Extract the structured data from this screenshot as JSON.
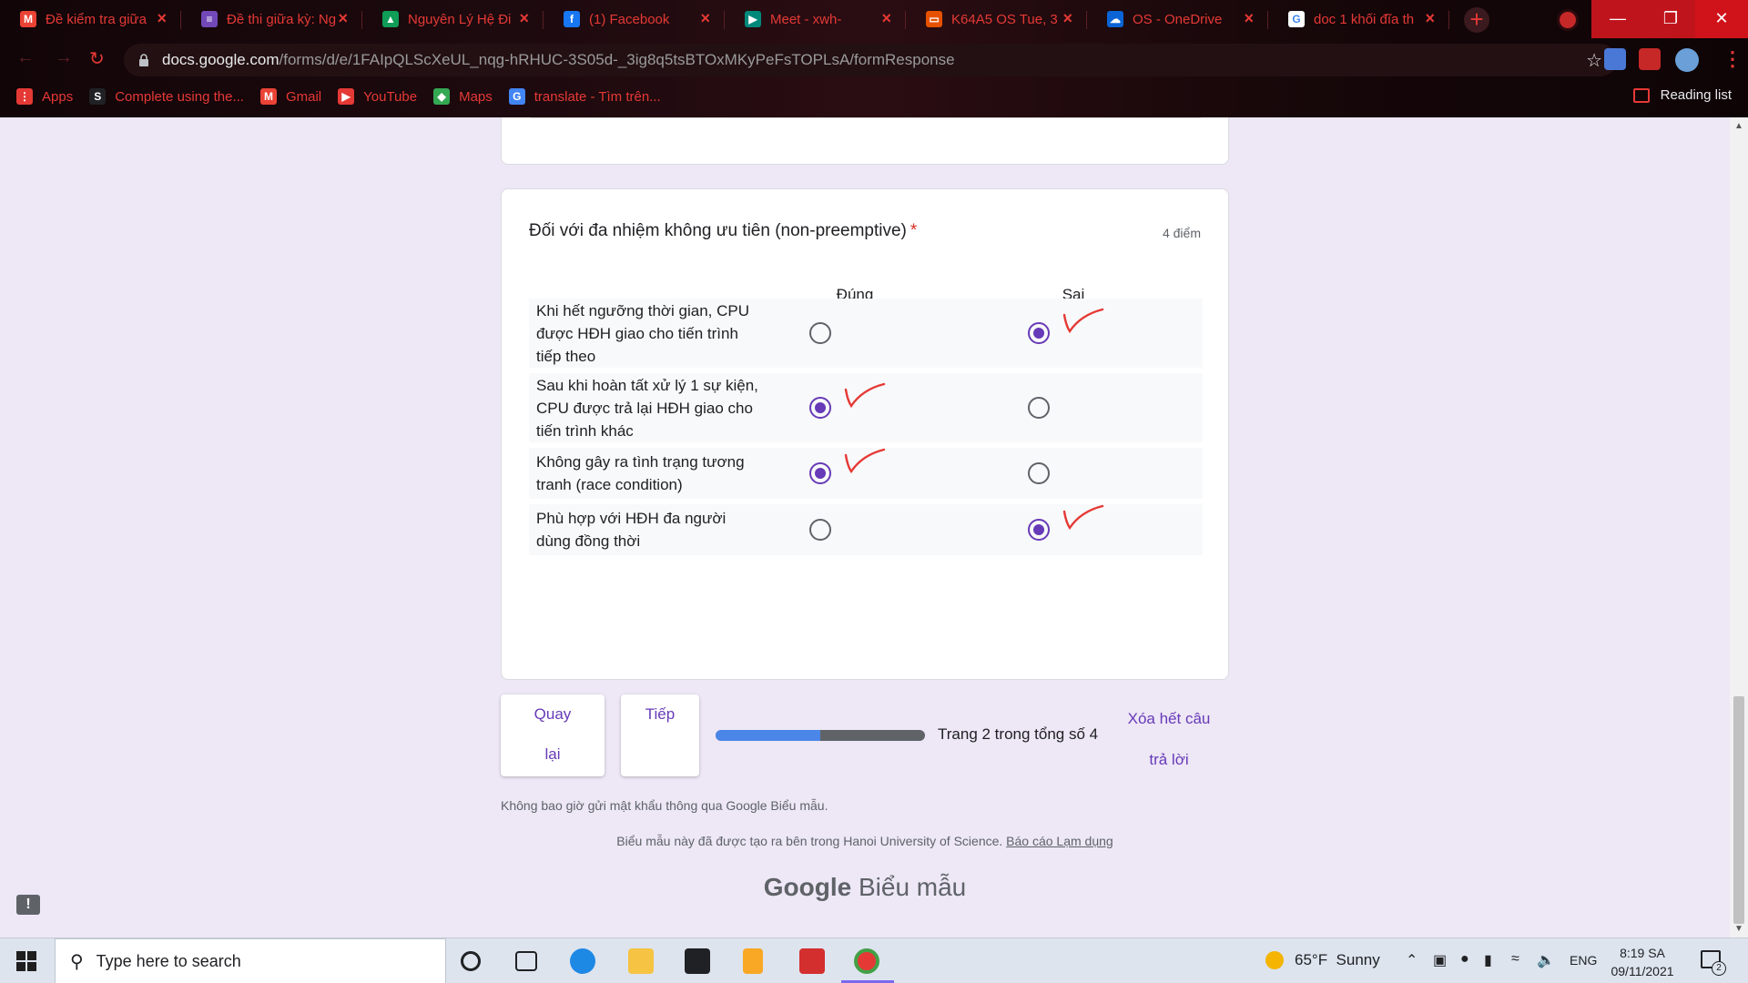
{
  "browser": {
    "tabs": [
      {
        "title": "Đề kiểm tra giữa",
        "favicon": "gmail-icon",
        "color": "#ea4335"
      },
      {
        "title": "Đề thi giữa kỳ: Ng",
        "favicon": "google-forms-icon",
        "color": "#7248b9"
      },
      {
        "title": "Nguyên Lý Hệ Đi",
        "favicon": "google-drive-icon",
        "color": "#0f9d58"
      },
      {
        "title": "(1) Facebook",
        "favicon": "facebook-icon",
        "color": "#1877f2"
      },
      {
        "title": "Meet - xwh-",
        "favicon": "google-meet-icon",
        "color": "#00897b"
      },
      {
        "title": "K64A5 OS Tue, 3",
        "favicon": "slides-icon",
        "color": "#e65100"
      },
      {
        "title": "OS - OneDrive",
        "favicon": "onedrive-icon",
        "color": "#0a64d6"
      },
      {
        "title": "doc 1 khối đĩa th",
        "favicon": "google-icon",
        "color": "#ffffff"
      }
    ],
    "url_host": "docs.google.com",
    "url_path": "/forms/d/e/1FAIpQLScXeUL_nqg-hRHUC-3S05d-_3ig8q5tsBTOxMKyPeFsTOPLsA/formResponse",
    "bookmarks": [
      {
        "label": "Apps",
        "icon": "apps-grid-icon"
      },
      {
        "label": "Complete using the...",
        "icon": "s-icon"
      },
      {
        "label": "Gmail",
        "icon": "gmail-icon"
      },
      {
        "label": "YouTube",
        "icon": "youtube-icon"
      },
      {
        "label": "Maps",
        "icon": "maps-icon"
      },
      {
        "label": "translate - Tìm trên...",
        "icon": "google-icon"
      }
    ],
    "reading_list": "Reading list"
  },
  "form": {
    "question": {
      "title": "Đối với đa nhiệm không ưu tiên (non-preemptive)",
      "required_mark": "*",
      "points": "4 điểm",
      "columns": [
        "Đúng",
        "Sai"
      ],
      "rows": [
        {
          "label": "Khi hết ngưỡng thời gian, CPU được HĐH giao cho tiến trình tiếp theo",
          "selected": 1
        },
        {
          "label": "Sau khi hoàn tất xử lý 1 sự kiện, CPU được trả lại HĐH giao cho tiến trình khác",
          "selected": 0
        },
        {
          "label": "Không gây ra tình trạng tương tranh (race condition)",
          "selected": 0
        },
        {
          "label": "Phù hợp với HĐH đa người dùng đồng thời",
          "selected": 1
        }
      ]
    },
    "nav": {
      "back_line1": "Quay",
      "back_line2": "lại",
      "next": "Tiếp",
      "progress_text": "Trang 2 trong tổng số 4",
      "progress_fraction": 0.5,
      "clear_line1": "Xóa hết câu",
      "clear_line2": "trả lời"
    },
    "password_note": "Không bao giờ gửi mật khẩu thông qua Google Biểu mẫu.",
    "footer_text": "Biểu mẫu này đã được tạo ra bên trong Hanoi University of Science.",
    "footer_link": "Báo cáo Lạm dụng",
    "brand_google": "Google",
    "brand_product": "Biểu mẫu",
    "accent_color": "#673ab7"
  },
  "taskbar": {
    "search_placeholder": "Type here to search",
    "weather_temp": "65°F",
    "weather_text": "Sunny",
    "language": "ENG",
    "time": "8:19 SA",
    "date": "09/11/2021",
    "notification_count": "2"
  }
}
